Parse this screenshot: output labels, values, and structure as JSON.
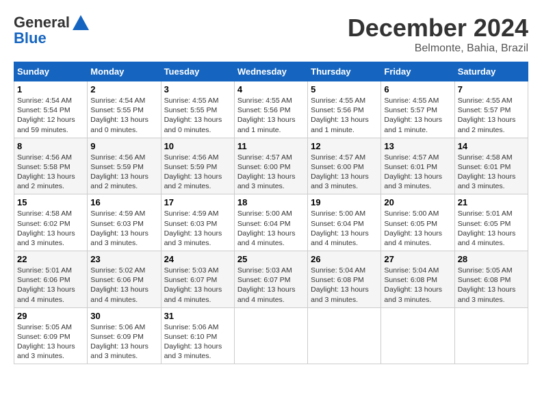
{
  "header": {
    "logo_line1": "General",
    "logo_line2": "Blue",
    "month_title": "December 2024",
    "location": "Belmonte, Bahia, Brazil"
  },
  "days_of_week": [
    "Sunday",
    "Monday",
    "Tuesday",
    "Wednesday",
    "Thursday",
    "Friday",
    "Saturday"
  ],
  "weeks": [
    [
      {
        "day": "1",
        "info": "Sunrise: 4:54 AM\nSunset: 5:54 PM\nDaylight: 12 hours\nand 59 minutes."
      },
      {
        "day": "2",
        "info": "Sunrise: 4:54 AM\nSunset: 5:55 PM\nDaylight: 13 hours\nand 0 minutes."
      },
      {
        "day": "3",
        "info": "Sunrise: 4:55 AM\nSunset: 5:55 PM\nDaylight: 13 hours\nand 0 minutes."
      },
      {
        "day": "4",
        "info": "Sunrise: 4:55 AM\nSunset: 5:56 PM\nDaylight: 13 hours\nand 1 minute."
      },
      {
        "day": "5",
        "info": "Sunrise: 4:55 AM\nSunset: 5:56 PM\nDaylight: 13 hours\nand 1 minute."
      },
      {
        "day": "6",
        "info": "Sunrise: 4:55 AM\nSunset: 5:57 PM\nDaylight: 13 hours\nand 1 minute."
      },
      {
        "day": "7",
        "info": "Sunrise: 4:55 AM\nSunset: 5:57 PM\nDaylight: 13 hours\nand 2 minutes."
      }
    ],
    [
      {
        "day": "8",
        "info": "Sunrise: 4:56 AM\nSunset: 5:58 PM\nDaylight: 13 hours\nand 2 minutes."
      },
      {
        "day": "9",
        "info": "Sunrise: 4:56 AM\nSunset: 5:59 PM\nDaylight: 13 hours\nand 2 minutes."
      },
      {
        "day": "10",
        "info": "Sunrise: 4:56 AM\nSunset: 5:59 PM\nDaylight: 13 hours\nand 2 minutes."
      },
      {
        "day": "11",
        "info": "Sunrise: 4:57 AM\nSunset: 6:00 PM\nDaylight: 13 hours\nand 3 minutes."
      },
      {
        "day": "12",
        "info": "Sunrise: 4:57 AM\nSunset: 6:00 PM\nDaylight: 13 hours\nand 3 minutes."
      },
      {
        "day": "13",
        "info": "Sunrise: 4:57 AM\nSunset: 6:01 PM\nDaylight: 13 hours\nand 3 minutes."
      },
      {
        "day": "14",
        "info": "Sunrise: 4:58 AM\nSunset: 6:01 PM\nDaylight: 13 hours\nand 3 minutes."
      }
    ],
    [
      {
        "day": "15",
        "info": "Sunrise: 4:58 AM\nSunset: 6:02 PM\nDaylight: 13 hours\nand 3 minutes."
      },
      {
        "day": "16",
        "info": "Sunrise: 4:59 AM\nSunset: 6:03 PM\nDaylight: 13 hours\nand 3 minutes."
      },
      {
        "day": "17",
        "info": "Sunrise: 4:59 AM\nSunset: 6:03 PM\nDaylight: 13 hours\nand 3 minutes."
      },
      {
        "day": "18",
        "info": "Sunrise: 5:00 AM\nSunset: 6:04 PM\nDaylight: 13 hours\nand 4 minutes."
      },
      {
        "day": "19",
        "info": "Sunrise: 5:00 AM\nSunset: 6:04 PM\nDaylight: 13 hours\nand 4 minutes."
      },
      {
        "day": "20",
        "info": "Sunrise: 5:00 AM\nSunset: 6:05 PM\nDaylight: 13 hours\nand 4 minutes."
      },
      {
        "day": "21",
        "info": "Sunrise: 5:01 AM\nSunset: 6:05 PM\nDaylight: 13 hours\nand 4 minutes."
      }
    ],
    [
      {
        "day": "22",
        "info": "Sunrise: 5:01 AM\nSunset: 6:06 PM\nDaylight: 13 hours\nand 4 minutes."
      },
      {
        "day": "23",
        "info": "Sunrise: 5:02 AM\nSunset: 6:06 PM\nDaylight: 13 hours\nand 4 minutes."
      },
      {
        "day": "24",
        "info": "Sunrise: 5:03 AM\nSunset: 6:07 PM\nDaylight: 13 hours\nand 4 minutes."
      },
      {
        "day": "25",
        "info": "Sunrise: 5:03 AM\nSunset: 6:07 PM\nDaylight: 13 hours\nand 4 minutes."
      },
      {
        "day": "26",
        "info": "Sunrise: 5:04 AM\nSunset: 6:08 PM\nDaylight: 13 hours\nand 3 minutes."
      },
      {
        "day": "27",
        "info": "Sunrise: 5:04 AM\nSunset: 6:08 PM\nDaylight: 13 hours\nand 3 minutes."
      },
      {
        "day": "28",
        "info": "Sunrise: 5:05 AM\nSunset: 6:08 PM\nDaylight: 13 hours\nand 3 minutes."
      }
    ],
    [
      {
        "day": "29",
        "info": "Sunrise: 5:05 AM\nSunset: 6:09 PM\nDaylight: 13 hours\nand 3 minutes."
      },
      {
        "day": "30",
        "info": "Sunrise: 5:06 AM\nSunset: 6:09 PM\nDaylight: 13 hours\nand 3 minutes."
      },
      {
        "day": "31",
        "info": "Sunrise: 5:06 AM\nSunset: 6:10 PM\nDaylight: 13 hours\nand 3 minutes."
      },
      null,
      null,
      null,
      null
    ]
  ]
}
